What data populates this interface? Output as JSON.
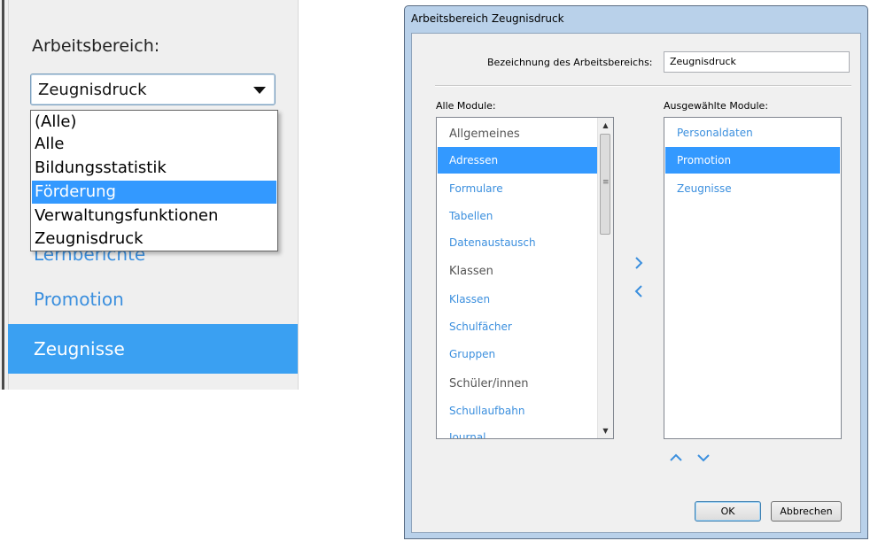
{
  "left_panel": {
    "workspace_label": "Arbeitsbereich:",
    "combo_value": "Zeugnisdruck",
    "dropdown_options": [
      "(Alle)",
      "Alle",
      "Bildungsstatistik",
      "Förderung",
      "Verwaltungsfunktionen",
      "Zeugnisdruck"
    ],
    "dropdown_highlighted": "Förderung",
    "partial_item": "Lernberichte",
    "items": [
      {
        "label": "Promotion",
        "selected": false
      },
      {
        "label": "Zeugnisse",
        "selected": true
      }
    ]
  },
  "dialog": {
    "title": "Arbeitsbereich Zeugnisdruck",
    "name_label": "Bezeichnung des Arbeitsbereichs:",
    "name_value": "Zeugnisdruck",
    "all_modules_label": "Alle Module:",
    "selected_modules_label": "Ausgewählte Module:",
    "all_modules": [
      {
        "label": "Allgemeines",
        "group": true
      },
      {
        "label": "Adressen",
        "selected": true
      },
      {
        "label": "Formulare"
      },
      {
        "label": "Tabellen"
      },
      {
        "label": "Datenaustausch"
      },
      {
        "label": "Klassen",
        "group": true
      },
      {
        "label": "Klassen"
      },
      {
        "label": "Schulfächer"
      },
      {
        "label": "Gruppen"
      },
      {
        "label": "Schüler/innen",
        "group": true
      },
      {
        "label": "Schullaufbahn"
      },
      {
        "label": "Journal"
      }
    ],
    "selected_modules": [
      {
        "label": "Personaldaten"
      },
      {
        "label": "Promotion",
        "selected": true
      },
      {
        "label": "Zeugnisse"
      }
    ],
    "ok_label": "OK",
    "cancel_label": "Abbrechen"
  },
  "icons": {
    "move_right": "chevron-right-icon",
    "move_left": "chevron-left-icon",
    "move_up": "chevron-up-icon",
    "move_down": "chevron-down-icon",
    "dropdown": "caret-down-icon"
  },
  "colors": {
    "selection": "#3399ff",
    "link_blue": "#3b8fde",
    "panel_bg": "#efefef",
    "dialog_frame": "#b9d1ea"
  }
}
